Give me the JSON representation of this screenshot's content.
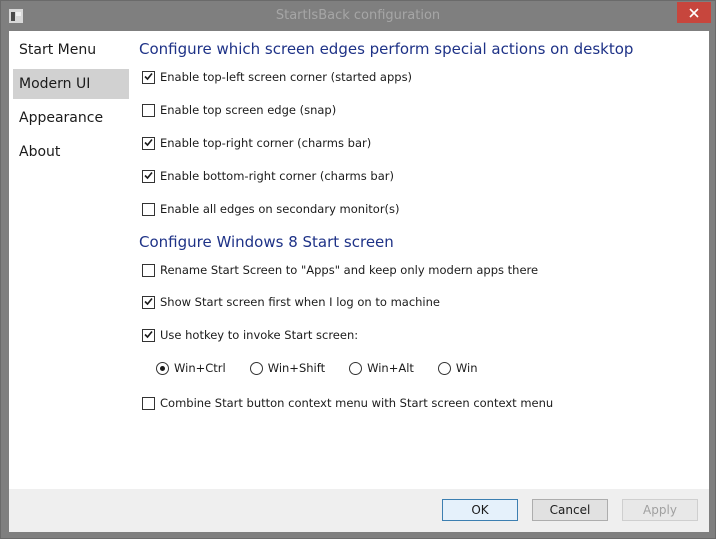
{
  "window": {
    "title": "StartIsBack configuration"
  },
  "sidebar": {
    "items": [
      {
        "label": "Start Menu"
      },
      {
        "label": "Modern UI",
        "selected": true
      },
      {
        "label": "Appearance"
      },
      {
        "label": "About"
      }
    ]
  },
  "edges": {
    "heading": "Configure which screen edges perform special actions on desktop",
    "options": [
      {
        "label": "Enable top-left screen corner (started apps)",
        "checked": true
      },
      {
        "label": "Enable top screen edge (snap)",
        "checked": false
      },
      {
        "label": "Enable top-right corner (charms bar)",
        "checked": true
      },
      {
        "label": "Enable bottom-right corner (charms bar)",
        "checked": true
      },
      {
        "label": "Enable all edges on secondary monitor(s)",
        "checked": false
      }
    ]
  },
  "start_screen": {
    "heading": "Configure Windows 8 Start screen",
    "options": [
      {
        "label": "Rename Start Screen to \"Apps\" and keep only modern apps there",
        "checked": false
      },
      {
        "label": "Show Start screen first when I log on to machine",
        "checked": true
      },
      {
        "label": "Use hotkey to invoke Start screen:",
        "checked": true
      }
    ],
    "hotkeys": [
      {
        "label": "Win+Ctrl",
        "selected": true
      },
      {
        "label": "Win+Shift",
        "selected": false
      },
      {
        "label": "Win+Alt",
        "selected": false
      },
      {
        "label": "Win",
        "selected": false
      }
    ],
    "combine": {
      "label": "Combine Start button context menu with Start screen context menu",
      "checked": false
    }
  },
  "buttons": {
    "ok": "OK",
    "cancel": "Cancel",
    "apply": "Apply"
  },
  "colors": {
    "heading": "#1e3287",
    "close": "#c7463d",
    "selected_nav": "#d1d1d1"
  }
}
